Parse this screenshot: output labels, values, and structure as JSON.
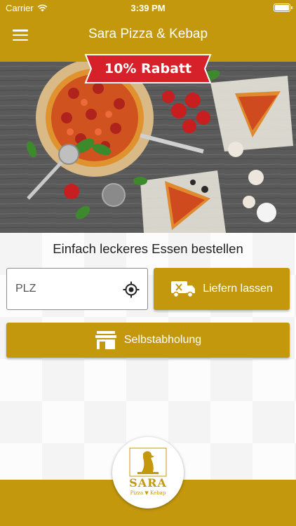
{
  "status_bar": {
    "carrier": "Carrier",
    "time": "3:39 PM",
    "icons": [
      "wifi-icon",
      "battery-icon"
    ]
  },
  "nav": {
    "title": "Sara Pizza & Kebap",
    "menu_icon": "hamburger-menu-icon"
  },
  "promo": {
    "badge_text": "10% Rabatt",
    "badge_color": "#d6212a"
  },
  "main": {
    "tagline": "Einfach leckeres Essen bestellen",
    "plz_placeholder": "PLZ",
    "locate_icon": "crosshair-location-icon",
    "deliver_label": "Liefern lassen",
    "deliver_icon": "delivery-truck-icon",
    "pickup_label": "Selbstabholung",
    "pickup_icon": "storefront-icon"
  },
  "logo": {
    "name": "SARA",
    "subtitle": "Pizza ▼ Kebap"
  },
  "colors": {
    "accent": "#c4980d",
    "text": "#222222"
  }
}
